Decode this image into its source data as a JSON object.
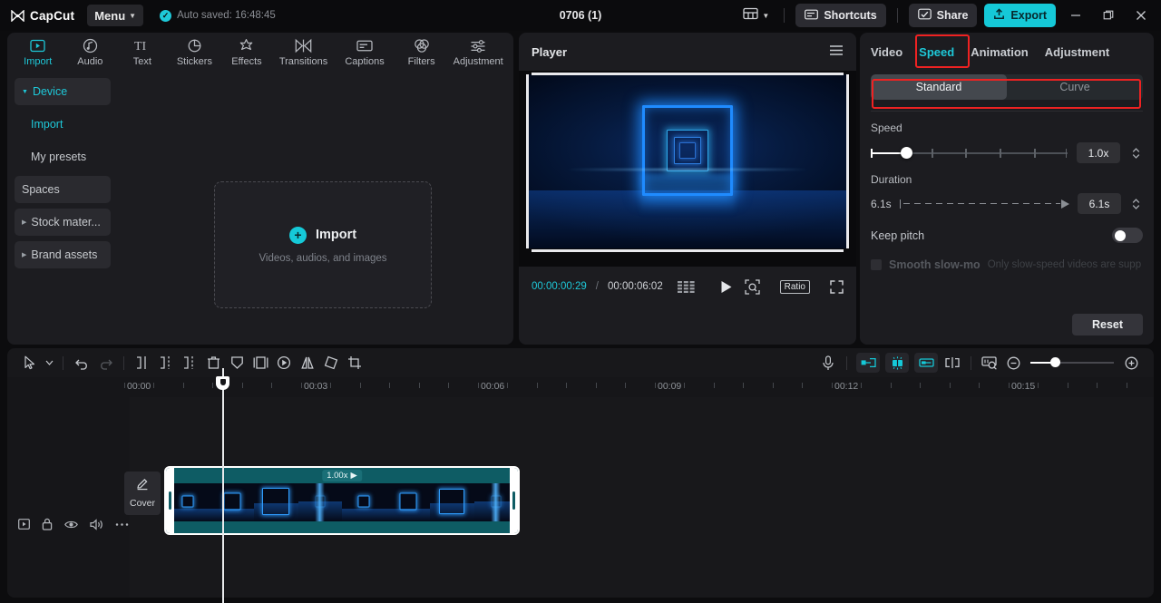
{
  "titlebar": {
    "app_name": "CapCut",
    "menu_label": "Menu",
    "autosave_text": "Auto saved: 16:48:45",
    "project_title": "0706 (1)",
    "shortcuts_label": "Shortcuts",
    "share_label": "Share",
    "export_label": "Export",
    "minimize_label": "—",
    "maximize_label": "❐",
    "close_label": "✕"
  },
  "media_tabs": [
    {
      "label": "Import",
      "icon": "media-import-icon",
      "active": true
    },
    {
      "label": "Audio",
      "icon": "audio-note-icon",
      "active": false
    },
    {
      "label": "Text",
      "icon": "text-ti-icon",
      "active": false
    },
    {
      "label": "Stickers",
      "icon": "sticker-icon",
      "active": false
    },
    {
      "label": "Effects",
      "icon": "effects-sparkle-icon",
      "active": false
    },
    {
      "label": "Transitions",
      "icon": "transitions-icon",
      "active": false
    },
    {
      "label": "Captions",
      "icon": "captions-icon",
      "active": false
    },
    {
      "label": "Filters",
      "icon": "filters-icon",
      "active": false
    },
    {
      "label": "Adjustment",
      "icon": "adjustment-sliders-icon",
      "active": false
    }
  ],
  "sidebar": {
    "items": [
      {
        "label": "Device",
        "type": "group",
        "expanded": true,
        "highlight": true
      },
      {
        "label": "Import",
        "type": "sub",
        "highlight": true
      },
      {
        "label": "My presets",
        "type": "sub",
        "highlight": false
      },
      {
        "label": "Spaces",
        "type": "group",
        "highlight": false
      },
      {
        "label": "Stock mater...",
        "type": "group",
        "expanded": false,
        "highlight": false
      },
      {
        "label": "Brand assets",
        "type": "group",
        "expanded": false,
        "highlight": false
      }
    ]
  },
  "dropzone": {
    "title": "Import",
    "subtitle": "Videos, audios, and images",
    "plus": "+"
  },
  "player": {
    "title": "Player",
    "current_time": "00:00:00:29",
    "separator": "/",
    "total_time": "00:00:06:02",
    "ratio_label": "Ratio"
  },
  "right_panel": {
    "tabs": [
      {
        "label": "Video",
        "active": false
      },
      {
        "label": "Speed",
        "active": true
      },
      {
        "label": "Animation",
        "active": false
      },
      {
        "label": "Adjustment",
        "active": false
      }
    ],
    "segments": [
      {
        "label": "Standard",
        "active": true
      },
      {
        "label": "Curve",
        "active": false
      }
    ],
    "speed_label": "Speed",
    "speed_value": "1.0x",
    "speed_knob_pct": 19,
    "duration_label": "Duration",
    "duration_left": "6.1s",
    "duration_value": "6.1s",
    "keep_pitch_label": "Keep pitch",
    "keep_pitch_on": false,
    "smooth_label": "Smooth slow-mo",
    "smooth_hint": "Only slow-speed videos are supp",
    "reset_label": "Reset"
  },
  "timeline": {
    "tools": [
      "select-arrow-icon",
      "chevron-down-icon",
      "undo-icon",
      "redo-icon",
      "split-left-icon",
      "split-icon",
      "split-right-icon",
      "delete-trash-icon",
      "mask-shield-icon",
      "freeze-frame-icon",
      "keyframe-icon",
      "mirror-icon",
      "rotate-icon",
      "crop-icon"
    ],
    "right_tools": [
      "microphone-icon",
      "auto-snap-left-icon",
      "magnet-snap-icon",
      "auto-snap-right-icon",
      "split-marker-icon",
      "thumbnail-preview-icon",
      "zoom-out-icon",
      "zoom-in-icon"
    ],
    "ruler_labels": [
      "00:00",
      "00:03",
      "00:06",
      "00:09",
      "00:12",
      "00:15"
    ],
    "track_icons": [
      "video-track-icon",
      "lock-icon",
      "eye-icon",
      "volume-icon",
      "more-dots-icon"
    ],
    "cover_label": "Cover",
    "clip_speed_label": "1.00x",
    "clip_play_glyph": "▶"
  },
  "colors": {
    "accent": "#15c9d8",
    "annotation": "#ee2222",
    "clip": "#0e5c64"
  }
}
